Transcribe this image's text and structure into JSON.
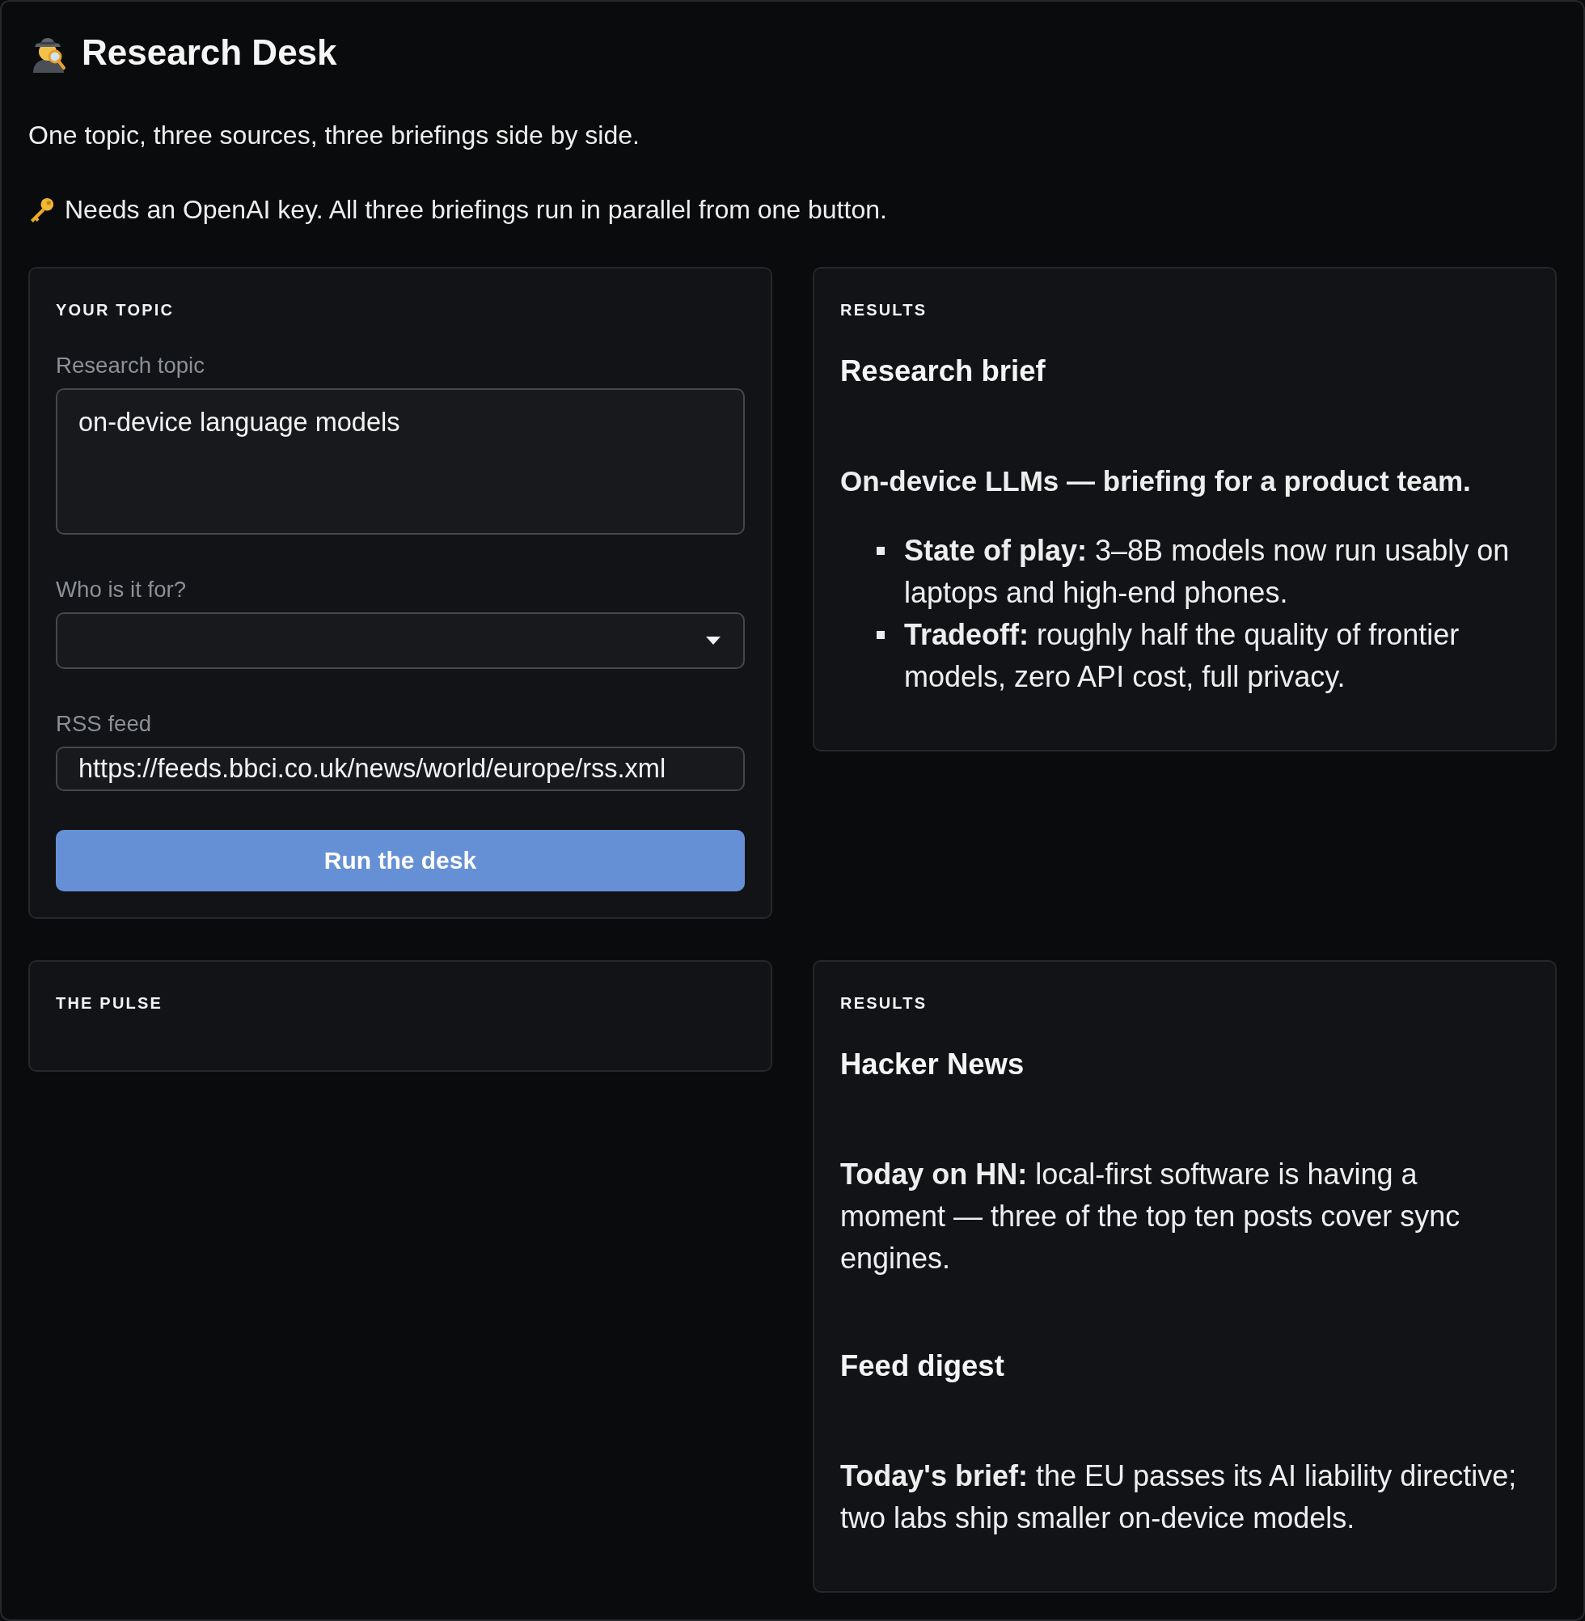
{
  "header": {
    "title": "Research Desk",
    "intro": "One topic, three sources, three briefings side by side.",
    "note": "Needs an OpenAI key. All three briefings run in parallel from one button."
  },
  "panels": [
    {
      "kind": "form",
      "heading": "YOUR TOPIC",
      "fields": [
        {
          "kind": "textarea",
          "label": "Research topic",
          "value": "on-device language models"
        },
        {
          "kind": "select",
          "label": "Who is it for?"
        },
        {
          "kind": "input",
          "label": "RSS feed",
          "value": "https://feeds.bbci.co.uk/news/world/europe/rss.xml"
        }
      ],
      "button": "Run the desk"
    },
    {
      "kind": "results",
      "heading": "RESULTS",
      "blocks": [
        {
          "kind": "heading",
          "text": "Research brief"
        },
        {
          "kind": "lead",
          "text": "On-device LLMs — briefing for a product team."
        },
        {
          "kind": "list",
          "items": [
            "**State of play:** 3–8B models now run usably on laptops and high-end phones.",
            "**Tradeoff:** roughly half the quality of frontier models, zero API cost, full privacy."
          ]
        }
      ]
    },
    {
      "kind": "empty",
      "heading": "THE PULSE"
    },
    {
      "kind": "results",
      "heading": "RESULTS",
      "blocks": [
        {
          "kind": "heading",
          "text": "Hacker News"
        },
        {
          "kind": "paragraph",
          "text": "**Today on HN:** local-first software is having a moment — three of the top ten posts cover sync engines."
        },
        {
          "kind": "heading",
          "text": "Feed digest"
        },
        {
          "kind": "paragraph",
          "text": "**Today's brief:** the EU passes its AI liability directive; two labs ship smaller on-device models."
        }
      ]
    }
  ]
}
